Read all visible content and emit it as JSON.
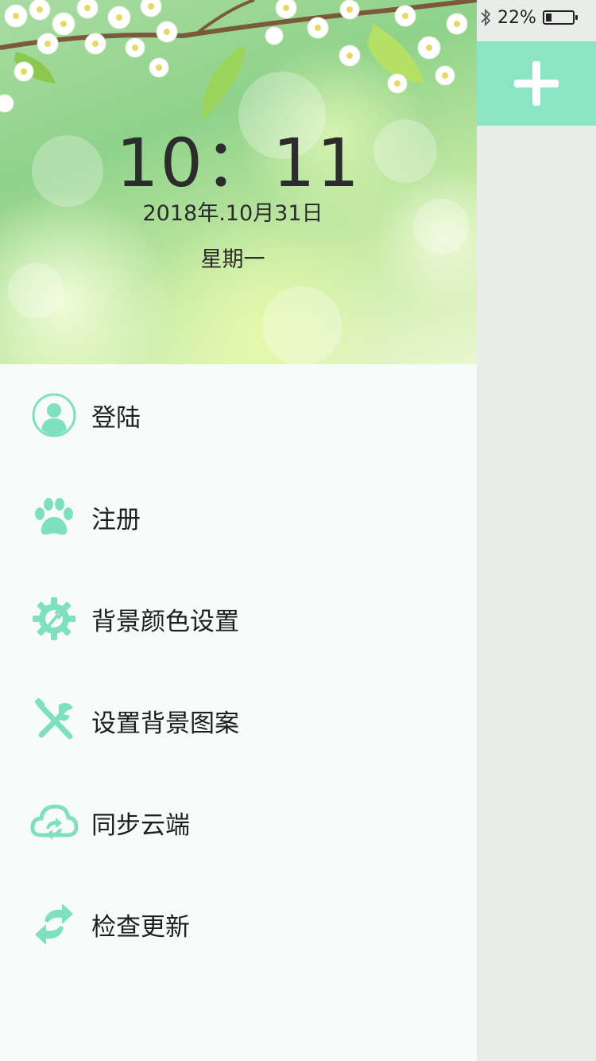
{
  "status_bar": {
    "battery_text": "22%",
    "battery_level": 0.22,
    "bluetooth_icon": "bluetooth-icon"
  },
  "add_button": {
    "icon": "plus-icon"
  },
  "header": {
    "time": "10：11",
    "date": "2018年.10月31日",
    "weekday": "星期一"
  },
  "menu": {
    "items": [
      {
        "label": "登陆",
        "icon": "user-icon"
      },
      {
        "label": "注册",
        "icon": "paw-icon"
      },
      {
        "label": "背景颜色设置",
        "icon": "gear-wrench-icon"
      },
      {
        "label": "设置背景图案",
        "icon": "tools-icon"
      },
      {
        "label": "同步云端",
        "icon": "cloud-sync-icon"
      },
      {
        "label": "检查更新",
        "icon": "refresh-icon"
      }
    ]
  },
  "colors": {
    "accent": "#8be4c4",
    "icon": "#7fe0c0",
    "drawer_bg": "#f7fcfa",
    "page_bg": "#eaecea"
  }
}
